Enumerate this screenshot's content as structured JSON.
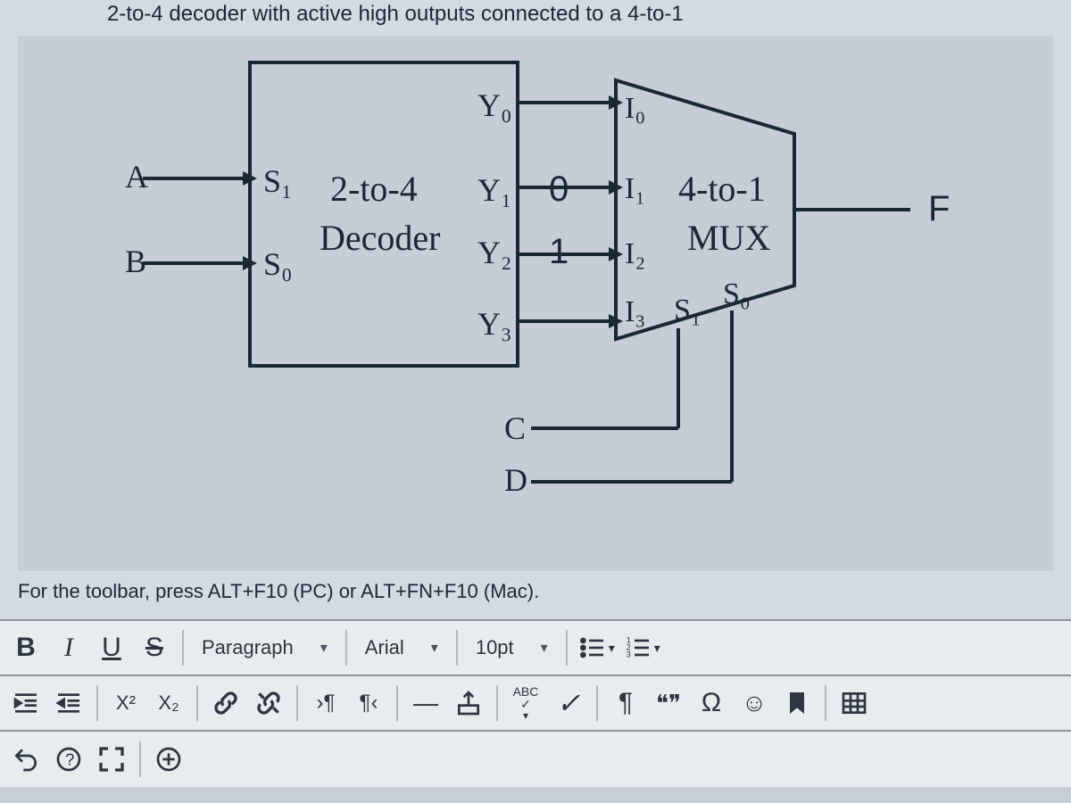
{
  "question": {
    "text_fragment": " 2-to-4 decoder with active high outputs connected to a 4-to-1"
  },
  "diagram": {
    "input_a": "A",
    "input_b": "B",
    "decoder_s1": "S₁",
    "decoder_s0": "S₀",
    "decoder_name_line1": "2-to-4",
    "decoder_name_line2": "Decoder",
    "y0": "Y₀",
    "y1": "Y₁",
    "y2": "Y₂",
    "y3": "Y₃",
    "const_0": "0",
    "const_1": "1",
    "input_c": "C",
    "input_d": "D",
    "mux_i0": "I₀",
    "mux_i1": "I₁",
    "mux_i2": "I₂",
    "mux_i3": "I₃",
    "mux_name_line1": "4-to-1",
    "mux_name_line2": "MUX",
    "mux_s1": "S₁",
    "mux_s0": "S₀",
    "output_f": "F"
  },
  "editor": {
    "hint": "For the toolbar, press ALT+F10 (PC) or ALT+FN+F10 (Mac).",
    "bold": "B",
    "italic": "I",
    "underline": "U",
    "strike": "S",
    "format_dropdown": "Paragraph",
    "font_dropdown": "Arial",
    "size_dropdown": "10pt",
    "superscript": "X²",
    "subscript": "X₂",
    "ltr": "›¶",
    "rtl": "¶‹",
    "dash": "—",
    "abc": "ABC",
    "check": "✓",
    "pilcrow": "¶",
    "quote": "❝❞",
    "omega": "Ω",
    "smiley": "☺",
    "bookmark_icon": "bookmark",
    "plus": "+"
  }
}
